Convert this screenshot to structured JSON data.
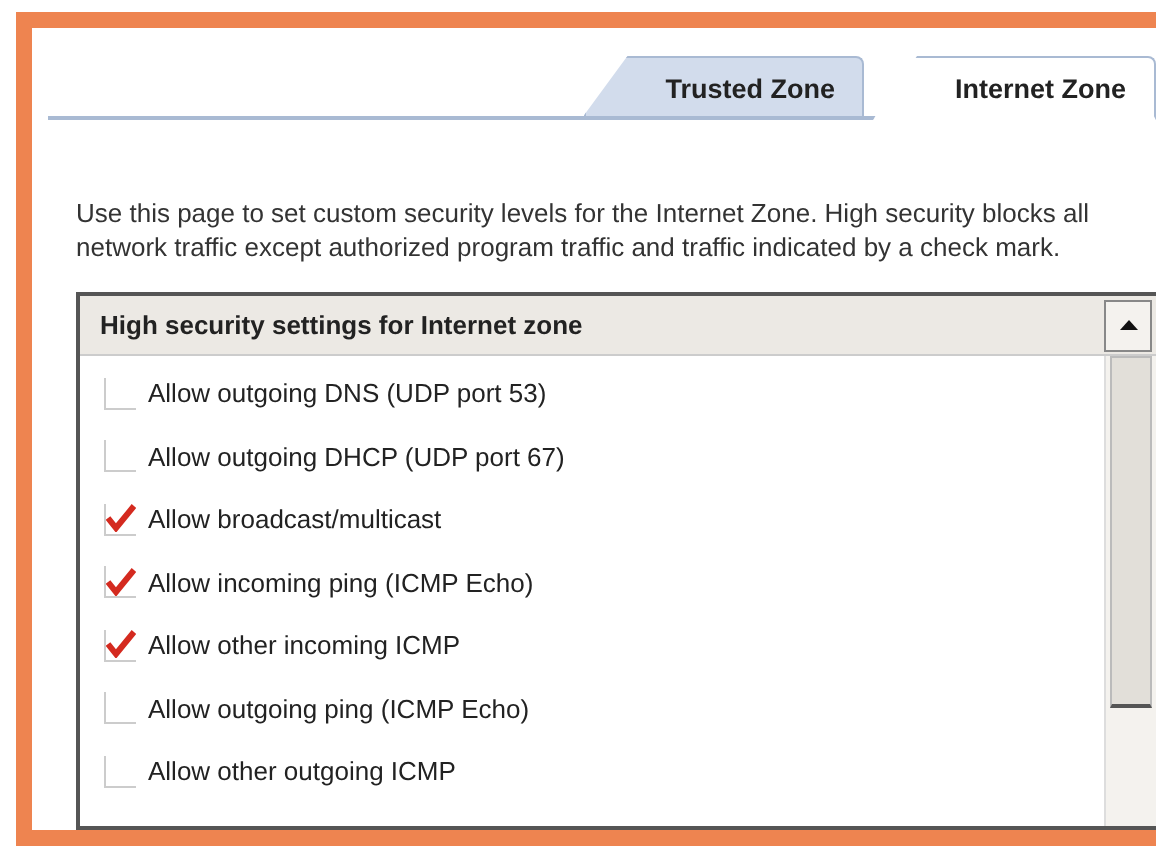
{
  "tabs": [
    {
      "label": "Trusted Zone",
      "selected": false
    },
    {
      "label": "Internet Zone",
      "selected": true
    }
  ],
  "description": "Use this page to set custom security levels for the Internet Zone.  High security blocks all network traffic except authorized program traffic and traffic indicated by a check mark.",
  "settings_list": {
    "header": "High security settings for Internet zone",
    "items": [
      {
        "label": "Allow outgoing DNS (UDP port 53)",
        "checked": false
      },
      {
        "label": "Allow outgoing DHCP (UDP port 67)",
        "checked": false
      },
      {
        "label": "Allow broadcast/multicast",
        "checked": true
      },
      {
        "label": "Allow incoming ping (ICMP Echo)",
        "checked": true
      },
      {
        "label": "Allow other incoming ICMP",
        "checked": true
      },
      {
        "label": "Allow outgoing ping (ICMP Echo)",
        "checked": false
      },
      {
        "label": "Allow other outgoing ICMP",
        "checked": false
      }
    ]
  }
}
